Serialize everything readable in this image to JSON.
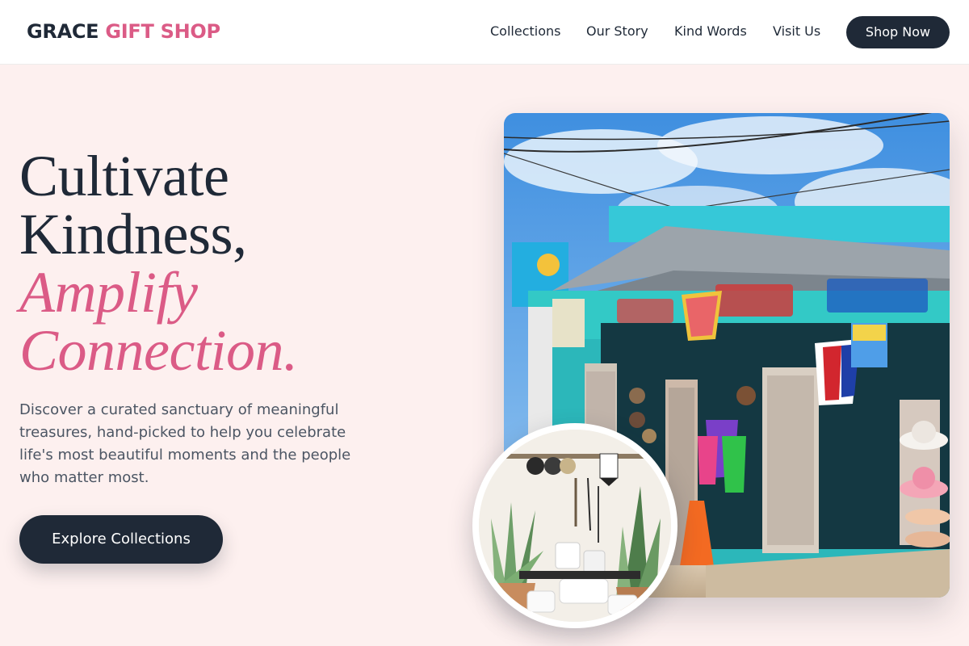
{
  "brand": {
    "name_part1": "GRACE",
    "name_part2": "GIFT SHOP"
  },
  "nav": {
    "links": [
      "Collections",
      "Our Story",
      "Kind Words",
      "Visit Us"
    ],
    "cta": "Shop Now"
  },
  "hero": {
    "title_line1": "Cultivate",
    "title_line2": "Kindness,",
    "title_line3": "Amplify",
    "title_line4": "Connection.",
    "description": "Discover a curated sanctuary of meaningful treasures, hand-picked to help you celebrate life's most beautiful moments and the people who matter most.",
    "cta": "Explore Collections",
    "main_image_alt": "Colorful storefront gift shop",
    "detail_image_alt": "Shop interior with plants and ceramics"
  },
  "colors": {
    "ink": "#1f2937",
    "accent": "#db5b86",
    "background": "#fdf0ef"
  }
}
